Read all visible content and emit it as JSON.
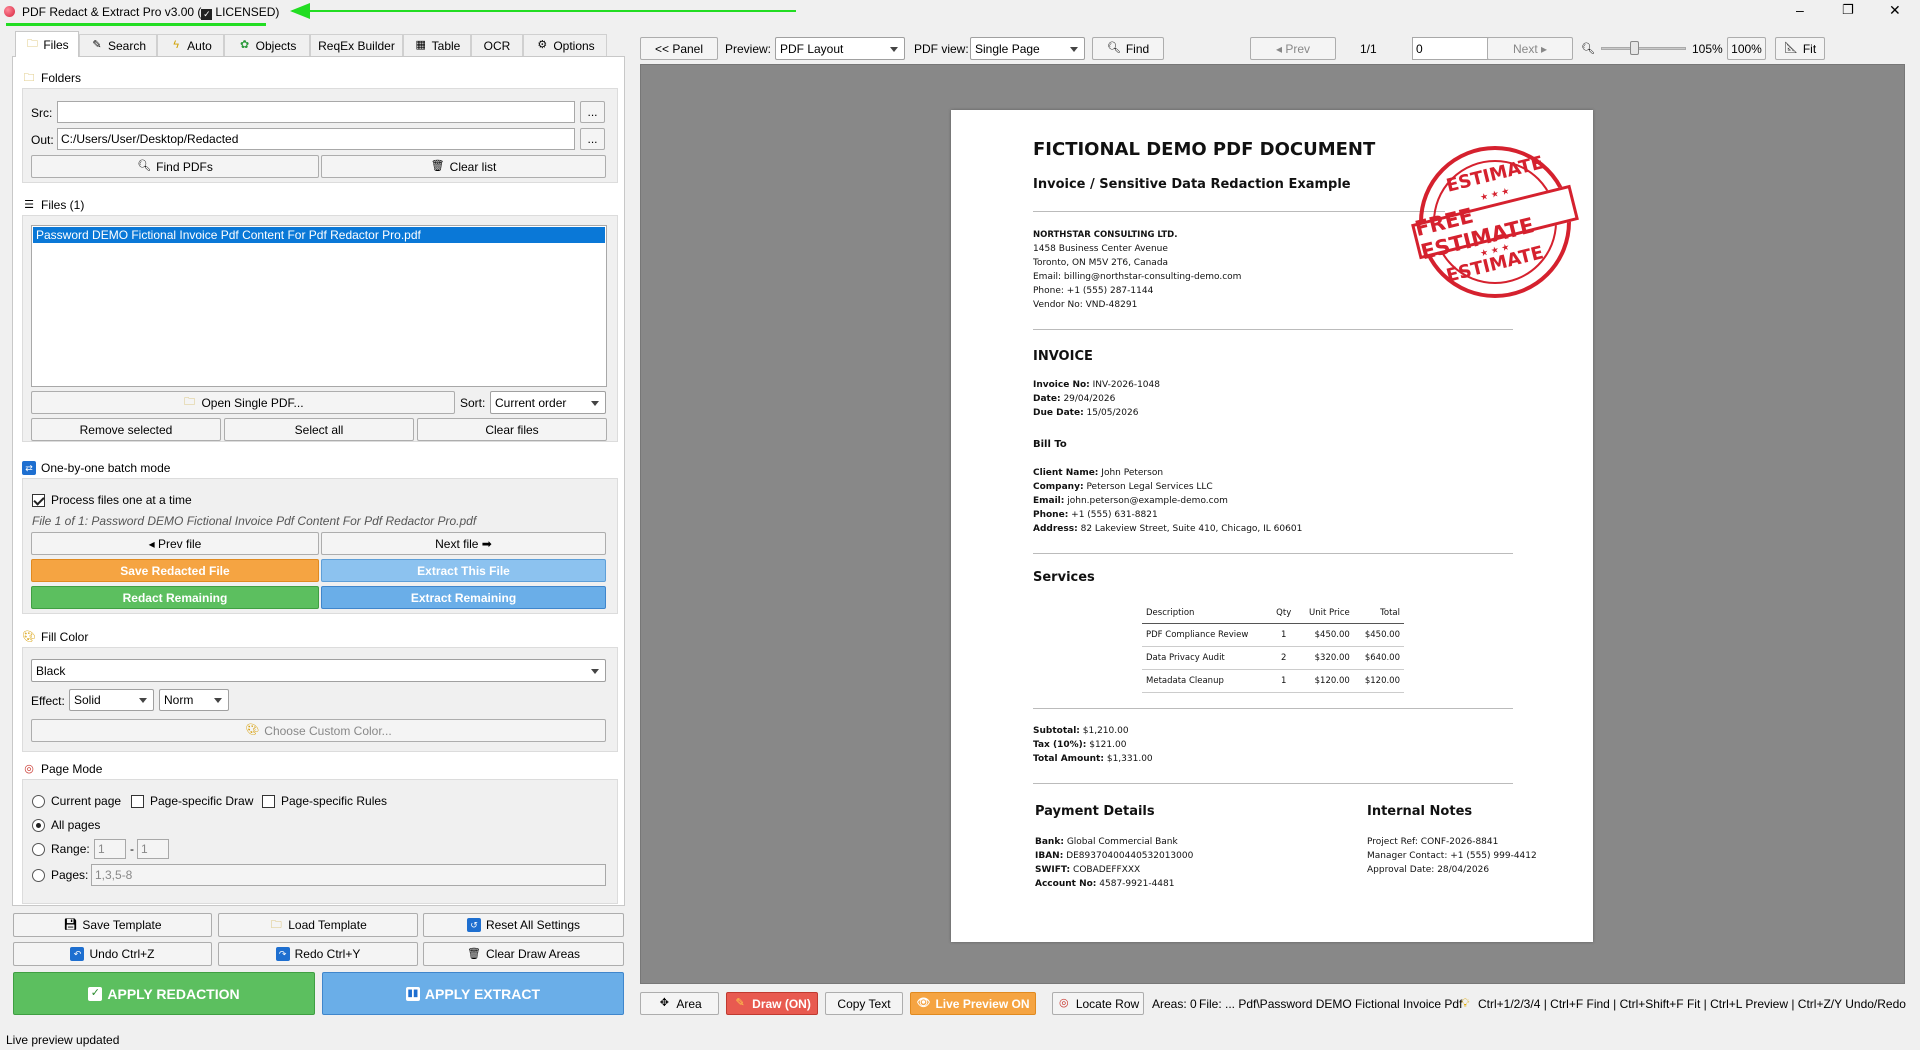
{
  "window": {
    "title": "PDF Redact & Extract Pro v3.00 (",
    "license": "LICENSED)",
    "minimize": "–",
    "maximize": "❐",
    "close": "✕"
  },
  "tabs": [
    {
      "label": "Files",
      "icon": "folder-icon"
    },
    {
      "label": "Search",
      "icon": "pencil-icon"
    },
    {
      "label": "Auto",
      "icon": "lightning-icon"
    },
    {
      "label": "Objects",
      "icon": "objects-icon"
    },
    {
      "label": "ReqEx Builder"
    },
    {
      "label": "Table",
      "icon": "table-icon"
    },
    {
      "label": "OCR"
    },
    {
      "label": "Options",
      "icon": "gear-icon"
    }
  ],
  "folders": {
    "title": "Folders",
    "src_label": "Src:",
    "src_value": "",
    "out_label": "Out:",
    "out_value": "C:/Users/User/Desktop/Redacted",
    "browse": "...",
    "find_pdfs": "Find PDFs",
    "clear_list": "Clear list"
  },
  "files": {
    "title": "Files (1)",
    "items": [
      "Password DEMO Fictional Invoice Pdf Content For Pdf Redactor Pro.pdf"
    ],
    "open_single": "Open Single PDF...",
    "sort_label": "Sort:",
    "sort_value": "Current order",
    "remove_selected": "Remove selected",
    "select_all": "Select all",
    "clear_files": "Clear files"
  },
  "batch": {
    "title": "One-by-one batch mode",
    "process_one": "Process files one at a time",
    "status": "File 1 of 1: Password DEMO Fictional Invoice Pdf Content For Pdf Redactor Pro.pdf",
    "prev_file": "◂ Prev file",
    "next_file": "Next file ➡",
    "save_redacted": "Save Redacted File",
    "extract_this": "Extract This File",
    "redact_remaining": "Redact Remaining",
    "extract_remaining": "Extract Remaining"
  },
  "fill": {
    "title": "Fill Color",
    "color_value": "Black",
    "effect_label": "Effect:",
    "effect_value": "Solid",
    "norm_value": "Norm",
    "choose_custom": "Choose Custom Color..."
  },
  "page_mode": {
    "title": "Page Mode",
    "current_page": "Current page",
    "page_specific_draw": "Page-specific Draw",
    "page_specific_rules": "Page-specific Rules",
    "all_pages": "All pages",
    "range_label": "Range:",
    "range_from": "1",
    "range_sep": "-",
    "range_to": "1",
    "pages_label": "Pages:",
    "pages_placeholder": "1,3,5-8"
  },
  "bottom": {
    "save_template": "Save Template",
    "load_template": "Load Template",
    "reset_all": "Reset All Settings",
    "undo": "Undo  Ctrl+Z",
    "redo": "Redo  Ctrl+Y",
    "clear_draw": "Clear Draw Areas",
    "apply_redaction": "APPLY REDACTION",
    "apply_extract": "APPLY EXTRACT"
  },
  "statusbar": "Live preview updated",
  "toolbar": {
    "panel": "<< Panel",
    "preview_label": "Preview:",
    "preview_value": "PDF Layout",
    "pdfview_label": "PDF view:",
    "pdfview_value": "Single Page",
    "find": "Find",
    "prev": "◂ Prev",
    "page_count": "1/1",
    "page_input": "0",
    "next": "Next ▸",
    "zoom_value": "105%",
    "zoom_100": "100%",
    "fit": "Fit",
    "zoom_fraction": 0.38
  },
  "bottom_toolbar": {
    "area": "Area",
    "draw": "Draw (ON)",
    "copy_text": "Copy Text",
    "live_preview": "Live Preview ON",
    "locate_row": "Locate Row",
    "areas": "Areas: 0",
    "file": "File: ... Pdf\\Password DEMO Fictional Invoice Pdf",
    "shortcuts": "Ctrl+1/2/3/4 | Ctrl+F Find | Ctrl+Shift+F Fit | Ctrl+L Preview | Ctrl+Z/Y Undo/Redo"
  },
  "document": {
    "title": "FICTIONAL DEMO PDF DOCUMENT",
    "subtitle": "Invoice / Sensitive Data Redaction Example",
    "company": "NORTHSTAR CONSULTING LTD.",
    "address1": "1458 Business Center Avenue",
    "address2": "Toronto, ON M5V 2T6, Canada",
    "email": "Email: billing@northstar-consulting-demo.com",
    "phone": "Phone: +1 (555) 287-1144",
    "vendor": "Vendor No: VND-48291",
    "invoice_heading": "INVOICE",
    "invoice_no_label": "Invoice No:",
    "invoice_no": "INV-2026-1048",
    "date_label": "Date:",
    "date": "29/04/2026",
    "due_label": "Due Date:",
    "due": "15/05/2026",
    "bill_to": "Bill To",
    "client_label": "Client Name:",
    "client": "John Peterson",
    "bcompany_label": "Company:",
    "bcompany": "Peterson Legal Services LLC",
    "bemail_label": "Email:",
    "bemail": "john.peterson@example-demo.com",
    "bphone_label": "Phone:",
    "bphone": "+1 (555) 631-8821",
    "baddr_label": "Address:",
    "baddr": "82 Lakeview Street, Suite 410, Chicago, IL 60601",
    "services": "Services",
    "table_headers": [
      "Description",
      "Qty",
      "Unit Price",
      "Total"
    ],
    "table_rows": [
      [
        "PDF Compliance Review",
        "1",
        "$450.00",
        "$450.00"
      ],
      [
        "Data Privacy Audit",
        "2",
        "$320.00",
        "$640.00"
      ],
      [
        "Metadata Cleanup",
        "1",
        "$120.00",
        "$120.00"
      ]
    ],
    "subtotal_label": "Subtotal:",
    "subtotal": "$1,210.00",
    "tax_label": "Tax (10%):",
    "tax": "$121.00",
    "total_label": "Total Amount:",
    "total": "$1,331.00",
    "payment_heading": "Payment Details",
    "bank_label": "Bank:",
    "bank": "Global Commercial Bank",
    "iban_label": "IBAN:",
    "iban": "DE89370400440532013000",
    "swift_label": "SWIFT:",
    "swift": "COBADEFFXXX",
    "account_label": "Account No:",
    "account": "4587-9921-4481",
    "notes_heading": "Internal Notes",
    "project": "Project Ref: CONF-2026-8841",
    "manager": "Manager Contact: +1 (555) 999-4412",
    "approval": "Approval Date: 28/04/2026",
    "stamp_top": "ESTIMATE",
    "stamp_band": "FREE ESTIMATE",
    "stamp_bottom": "ESTIMATE"
  },
  "colors": {
    "orange": "#f5a442",
    "green": "#5cbf5f",
    "blue": "#6aaee8",
    "annotation_green": "#22dd22",
    "selection": "#0a78d7"
  }
}
